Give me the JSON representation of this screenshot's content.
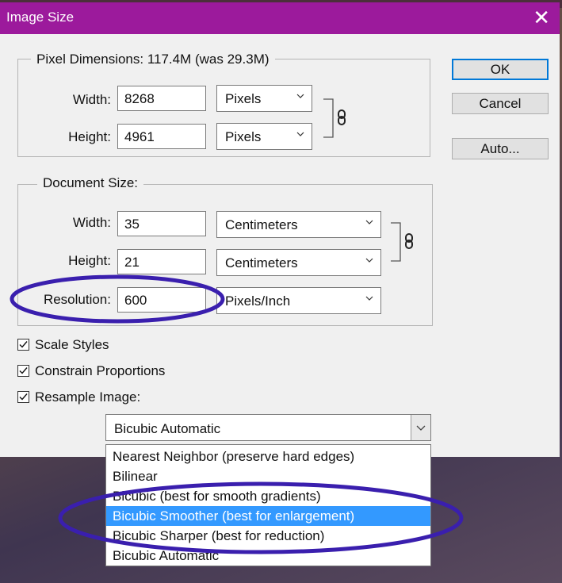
{
  "window": {
    "title": "Image Size",
    "close_glyph": "✕"
  },
  "pixel_dimensions": {
    "legend": "Pixel Dimensions:  117.4M (was 29.3M)",
    "width_label": "Width:",
    "width_value": "8268",
    "width_unit": "Pixels",
    "height_label": "Height:",
    "height_value": "4961",
    "height_unit": "Pixels"
  },
  "document_size": {
    "legend": "Document Size:",
    "width_label": "Width:",
    "width_value": "35",
    "width_unit": "Centimeters",
    "height_label": "Height:",
    "height_value": "21",
    "height_unit": "Centimeters",
    "resolution_label": "Resolution:",
    "resolution_value": "600",
    "resolution_unit": "Pixels/Inch"
  },
  "buttons": {
    "ok": "OK",
    "cancel": "Cancel",
    "auto": "Auto..."
  },
  "options": {
    "scale_styles": {
      "label": "Scale Styles",
      "checked": true
    },
    "constrain_proportions": {
      "label": "Constrain Proportions",
      "checked": true
    },
    "resample_image": {
      "label": "Resample Image:",
      "checked": true
    }
  },
  "resample_method": {
    "selected": "Bicubic Automatic",
    "highlighted": "Bicubic Smoother (best for enlargement)",
    "items": [
      "Nearest Neighbor (preserve hard edges)",
      "Bilinear",
      "Bicubic (best for smooth gradients)",
      "Bicubic Smoother (best for enlargement)",
      "Bicubic Sharper (best for reduction)",
      "Bicubic Automatic"
    ]
  },
  "colors": {
    "title_bar": "#9c1a9c",
    "highlight": "#3399ff",
    "annotation": "#3a1fae"
  },
  "icons": {
    "chain": "link-icon",
    "dropdown": "chevron-down-icon",
    "check": "checkmark-icon"
  }
}
